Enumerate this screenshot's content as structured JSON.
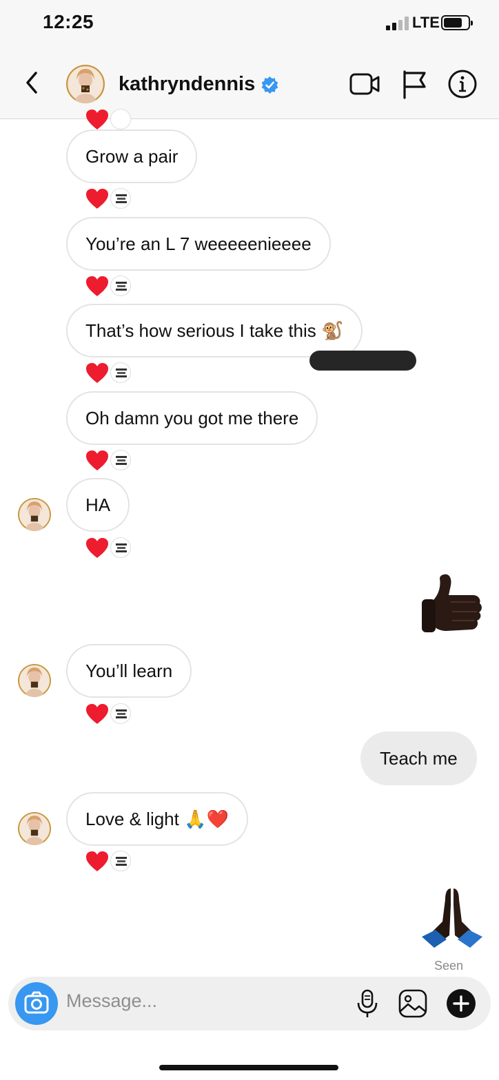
{
  "status_bar": {
    "time": "12:25",
    "network": "LTE",
    "battery_level": 0.75
  },
  "header": {
    "username": "kathryndennis",
    "verified": true,
    "icons": [
      "back-chevron-icon",
      "video-call-icon",
      "flag-icon",
      "info-icon"
    ]
  },
  "messages": [
    {
      "from": "them",
      "text": "Grow a pair",
      "reaction": "red-heart"
    },
    {
      "from": "them",
      "text": "You’re an L 7 weeeeenieeee",
      "reaction": "red-heart"
    },
    {
      "from": "them",
      "text": "That’s how serious I take this 🐒",
      "reaction": "red-heart"
    },
    {
      "from": "them",
      "text": "Oh damn you got me there",
      "reaction": "red-heart"
    },
    {
      "from": "them",
      "text": "HA",
      "reaction": "red-heart",
      "avatar": true
    },
    {
      "from": "me",
      "emoji": "thumbs-up-dark-skin"
    },
    {
      "from": "them",
      "text": "You’ll learn",
      "reaction": "red-heart",
      "avatar": true
    },
    {
      "from": "me",
      "text": "Teach me"
    },
    {
      "from": "them",
      "text": "Love & light 🙏❤️",
      "reaction": "red-heart",
      "avatar": true
    },
    {
      "from": "me",
      "emoji": "folded-hands-dark-skin"
    }
  ],
  "seen_label": "Seen",
  "composer": {
    "placeholder": "Message...",
    "icons": [
      "camera-icon",
      "microphone-icon",
      "gallery-icon",
      "plus-icon"
    ]
  },
  "colors": {
    "accent": "#3897f0",
    "heart": "#ed1c2e",
    "sent_bubble": "#ebebeb"
  }
}
